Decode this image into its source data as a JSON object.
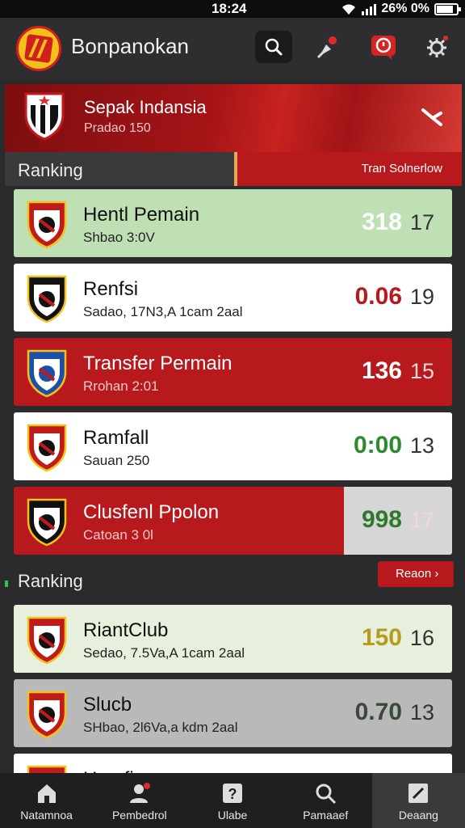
{
  "status": {
    "time": "18:24",
    "battery": "26% 0%"
  },
  "app": {
    "name": "Bonpanokan"
  },
  "banner": {
    "title": "Sepak Indansia",
    "subtitle": "Pradao 150"
  },
  "section1": {
    "title": "Ranking",
    "tab_label": "Tran Solnerlow"
  },
  "rows1": [
    {
      "name": "Hentl Pemain",
      "sub": "Shbao 3:0V",
      "score": "318",
      "num": "17",
      "bg": "#bfe0b5",
      "score_color": "#ffffff"
    },
    {
      "name": "Renfsi",
      "sub": "Sadao, 17N3,A 1cam 2aal",
      "score": "0.06",
      "num": "19",
      "bg": "#ffffff",
      "score_color": "#b8191c"
    },
    {
      "name": "Transfer Permain",
      "sub": "Rrohan 2:01",
      "score": "136",
      "num": "15",
      "bg": "#b8191c",
      "score_color": "#ffffff"
    },
    {
      "name": "Ramfall",
      "sub": "Sauan 250",
      "score": "0:00",
      "num": "13",
      "bg": "#ffffff",
      "score_color": "#2d8a2d"
    },
    {
      "name": "Clusfenl Ppolon",
      "sub": "Catoan 3 0l",
      "score": "998",
      "num": "17",
      "bg": "#b8191c",
      "score_color": "#2d7a2d"
    }
  ],
  "section2": {
    "title": "Ranking",
    "more_label": "Reaon ›"
  },
  "rows2": [
    {
      "name": "RiantClub",
      "sub": "Sedao, 7.5Va,A 1cam 2aal",
      "score": "150",
      "num": "16",
      "bg": "#e6f0dc",
      "score_color": "#b8991c"
    },
    {
      "name": "Slucb",
      "sub": "SHbao, 2l6Va,a kdm 2aal",
      "score": "0.70",
      "num": "13",
      "bg": "#b9b9b9",
      "score_color": "#3a4a3a"
    },
    {
      "name": "Hemfi",
      "sub": "",
      "score": "",
      "num": "",
      "bg": "#ffffff",
      "score_color": "#222222"
    }
  ],
  "nav": [
    {
      "label": "Natamnoa",
      "icon": "home-icon"
    },
    {
      "label": "Pembedrol",
      "icon": "person-notification-icon"
    },
    {
      "label": "Ulabe",
      "icon": "question-card-icon"
    },
    {
      "label": "Pamaaef",
      "icon": "search-icon"
    },
    {
      "label": "Deaang",
      "icon": "edit-icon"
    }
  ],
  "colors": {
    "accent_red": "#b8191c",
    "header_bg": "#2e2e30",
    "body_bg": "#2b2b2d"
  }
}
